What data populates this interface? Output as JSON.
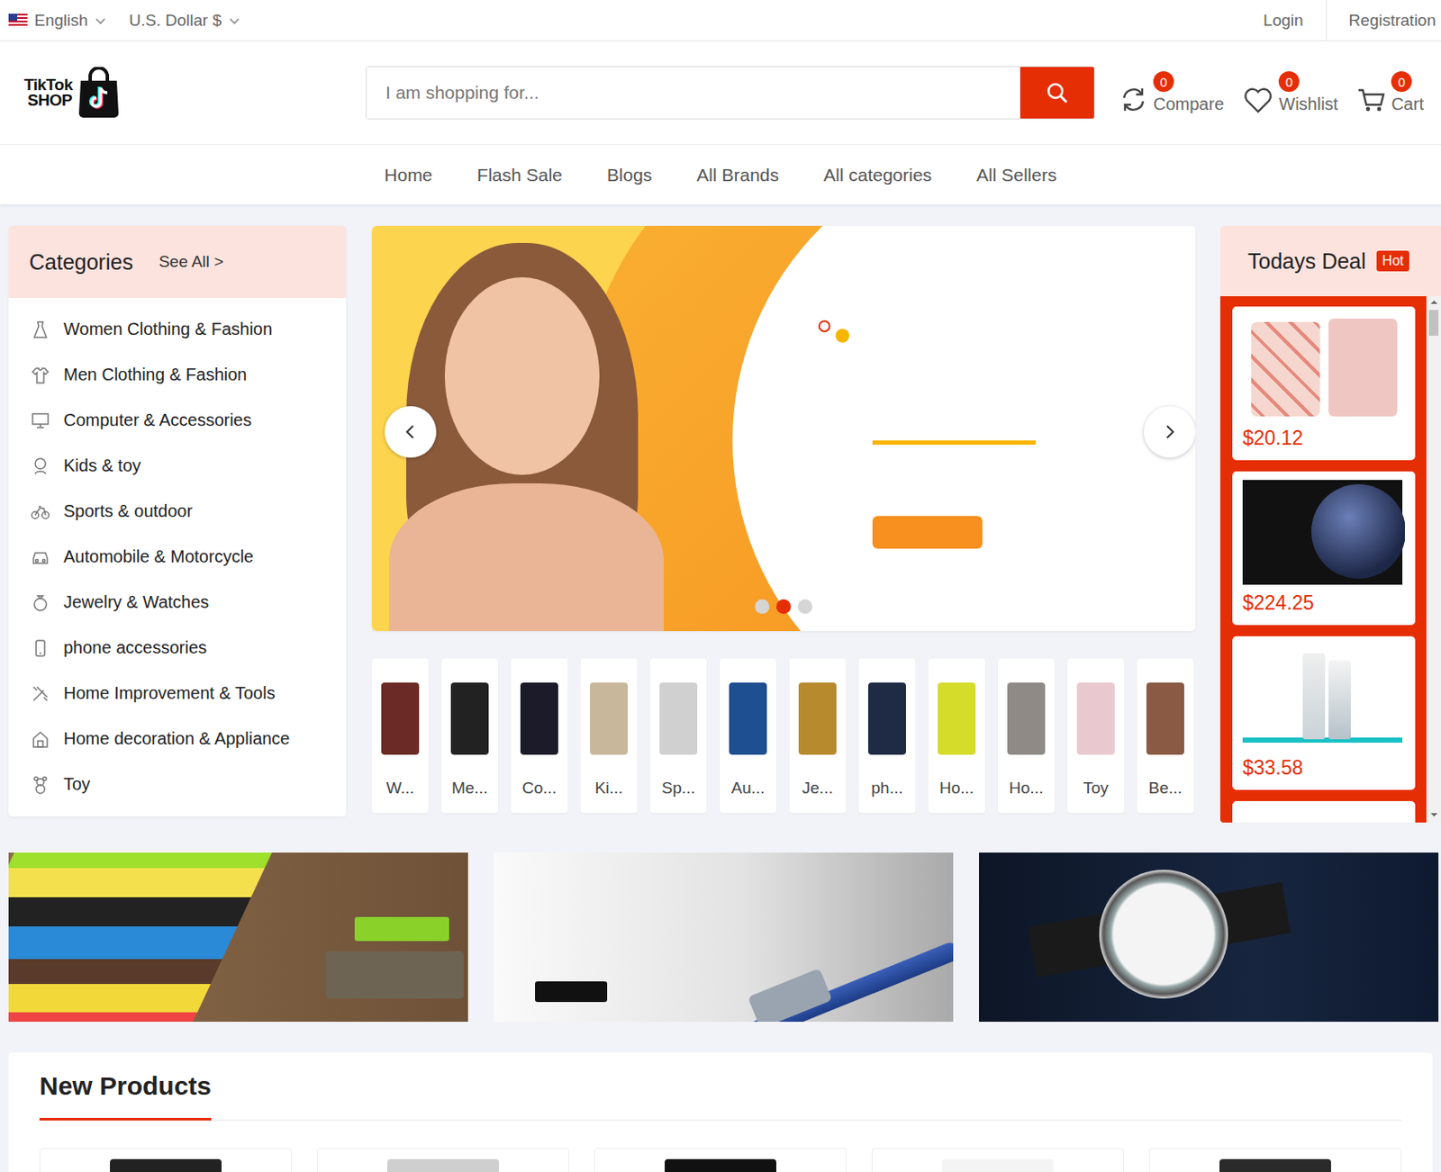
{
  "topbar": {
    "language": "English",
    "currency": "U.S. Dollar $",
    "links": [
      "Login",
      "Registration"
    ]
  },
  "logo": {
    "line1": "TikTok",
    "line2": "SHOP"
  },
  "search": {
    "placeholder": "I am shopping for..."
  },
  "actions": [
    {
      "label": "Compare",
      "count": "0"
    },
    {
      "label": "Wishlist",
      "count": "0"
    },
    {
      "label": "Cart",
      "count": "0"
    }
  ],
  "nav": [
    "Home",
    "Flash Sale",
    "Blogs",
    "All Brands",
    "All categories",
    "All Sellers"
  ],
  "categories": {
    "title": "Categories",
    "see_all": "See All >",
    "items": [
      "Women Clothing & Fashion",
      "Men Clothing & Fashion",
      "Computer & Accessories",
      "Kids & toy",
      "Sports & outdoor",
      "Automobile & Motorcycle",
      "Jewelry & Watches",
      "phone accessories",
      "Home Improvement & Tools",
      "Home decoration & Appliance",
      "Toy"
    ]
  },
  "slider": {
    "dots": [
      {
        "selected": false
      },
      {
        "selected": true
      },
      {
        "selected": false
      }
    ]
  },
  "category_strip": [
    "W...",
    "Me...",
    "Co...",
    "Ki...",
    "Sp...",
    "Au...",
    "Je...",
    "ph...",
    "Ho...",
    "Ho...",
    "Toy",
    "Be..."
  ],
  "todays_deal": {
    "title": "Todays Deal",
    "badge": "Hot",
    "items": [
      {
        "price": "$20.12"
      },
      {
        "price": "$224.25"
      },
      {
        "price": "$33.58"
      }
    ]
  },
  "new_products": {
    "title": "New Products"
  }
}
